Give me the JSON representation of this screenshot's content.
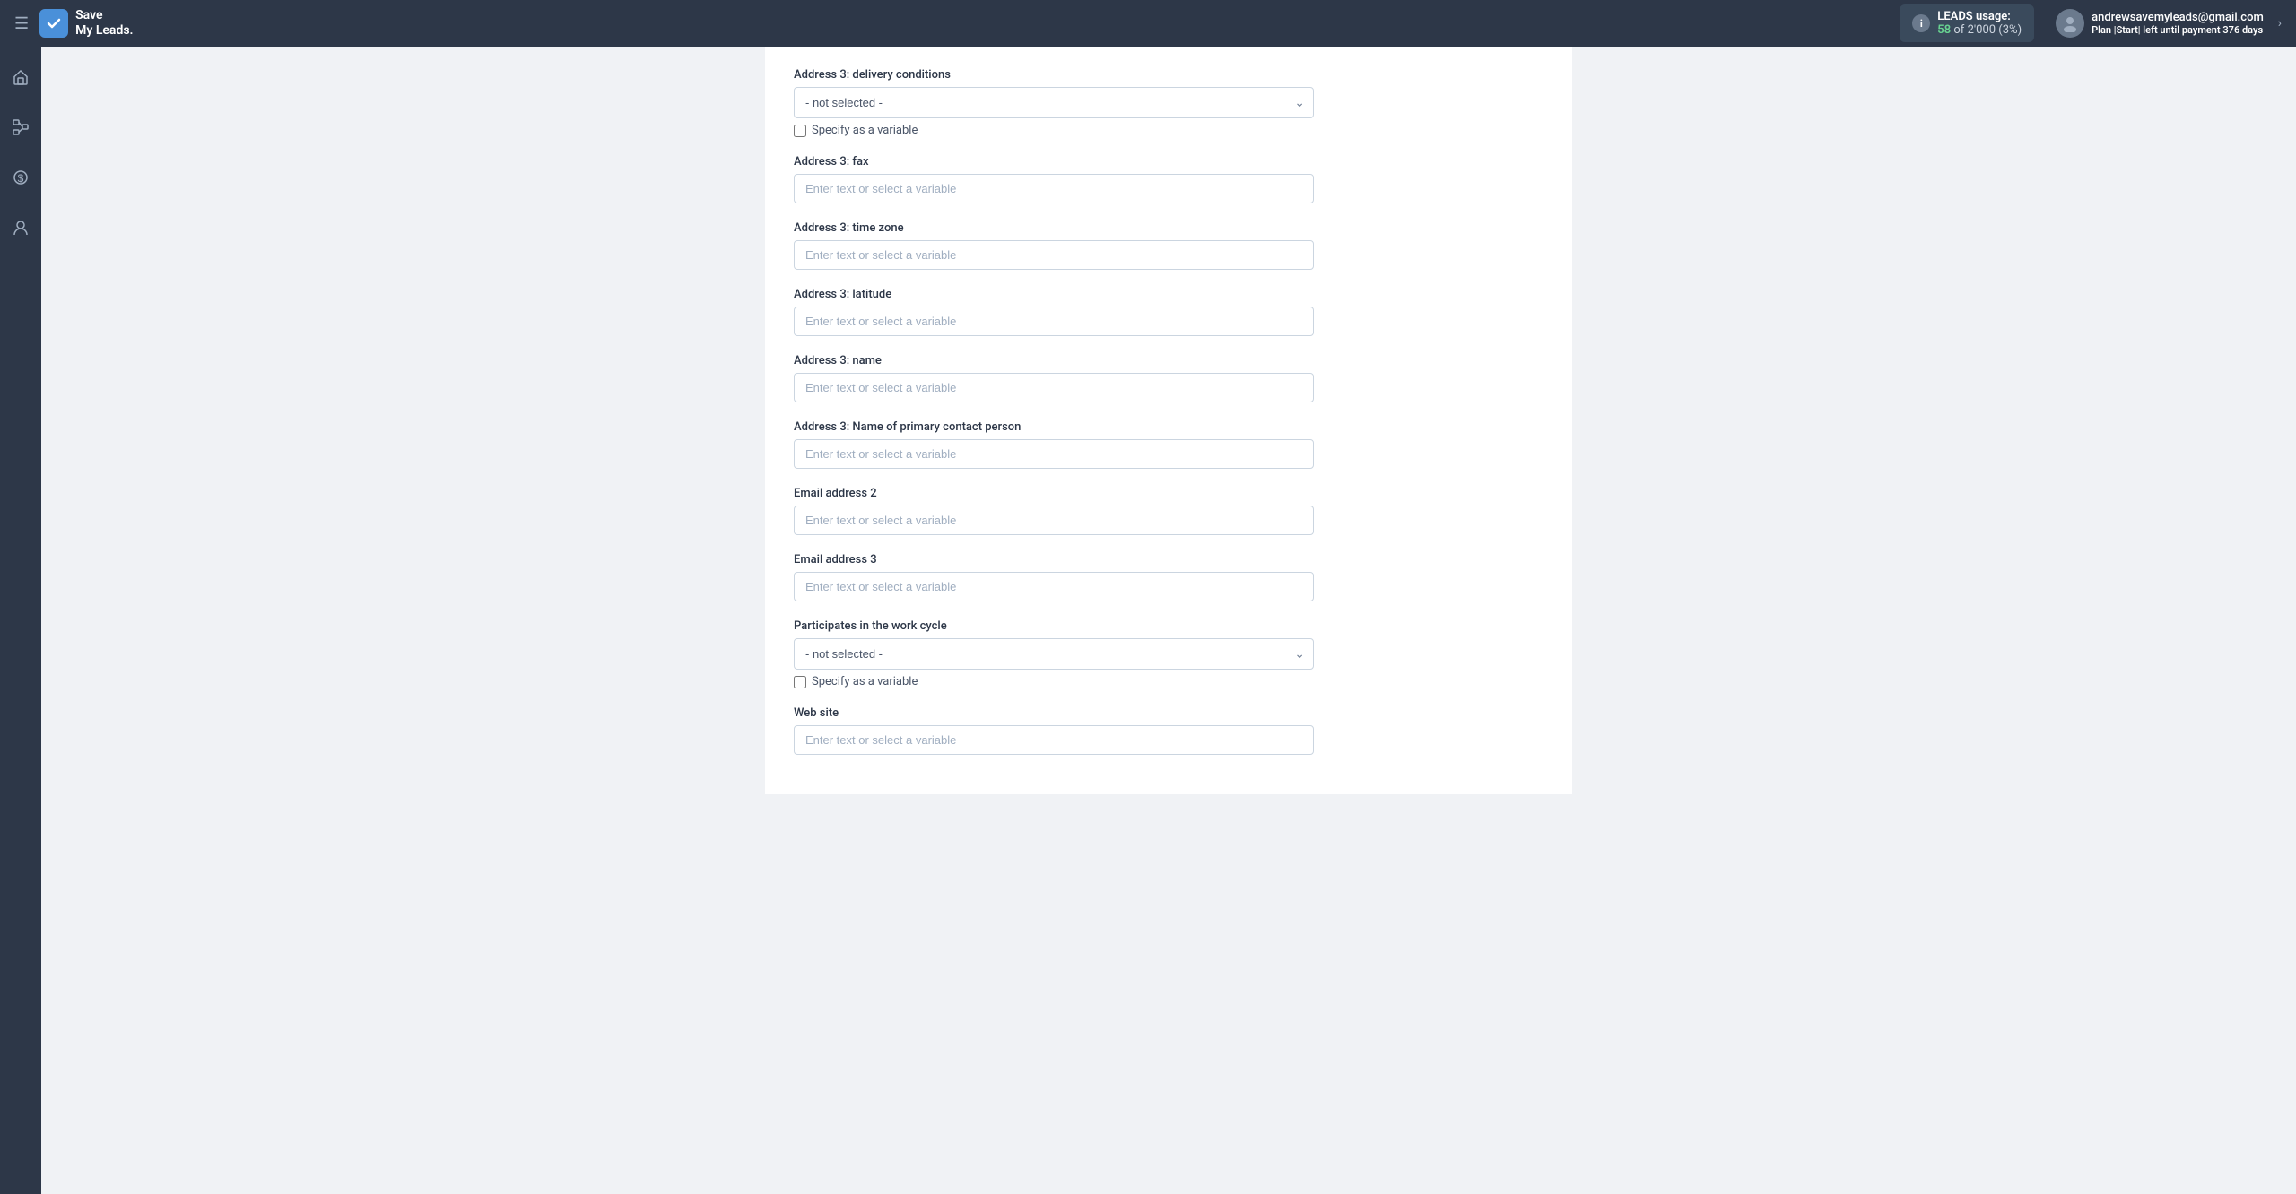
{
  "topbar": {
    "menu_icon": "☰",
    "logo_check": "✓",
    "logo_line1": "Save",
    "logo_line2": "My Leads.",
    "leads_label": "LEADS usage:",
    "leads_used": "58",
    "leads_total": "2'000",
    "leads_pct": "(3%)",
    "user_email": "andrewsavemyleads@gmail.com",
    "user_plan_text": "Plan |Start| left until payment",
    "user_days": "376 days",
    "chevron": "›"
  },
  "sidebar": {
    "icons": [
      "⌂",
      "⊞",
      "$",
      "👤"
    ]
  },
  "form": {
    "fields": [
      {
        "type": "select",
        "label": "Address 3: delivery conditions",
        "value": "- not selected -",
        "has_checkbox": true,
        "checkbox_label": "Specify as a variable",
        "id": "delivery-conditions"
      },
      {
        "type": "input",
        "label": "Address 3: fax",
        "placeholder": "Enter text or select a variable",
        "id": "fax"
      },
      {
        "type": "input",
        "label": "Address 3: time zone",
        "placeholder": "Enter text or select a variable",
        "id": "time-zone"
      },
      {
        "type": "input",
        "label": "Address 3: latitude",
        "placeholder": "Enter text or select a variable",
        "id": "latitude"
      },
      {
        "type": "input",
        "label": "Address 3: name",
        "placeholder": "Enter text or select a variable",
        "id": "name"
      },
      {
        "type": "input",
        "label": "Address 3: Name of primary contact person",
        "placeholder": "Enter text or select a variable",
        "id": "primary-contact"
      },
      {
        "type": "input",
        "label": "Email address 2",
        "placeholder": "Enter text or select a variable",
        "id": "email-2"
      },
      {
        "type": "input",
        "label": "Email address 3",
        "placeholder": "Enter text or select a variable",
        "id": "email-3"
      },
      {
        "type": "select",
        "label": "Participates in the work cycle",
        "value": "- not selected -",
        "has_checkbox": true,
        "checkbox_label": "Specify as a variable",
        "id": "work-cycle"
      },
      {
        "type": "input",
        "label": "Web site",
        "placeholder": "Enter text or select a variable",
        "id": "website"
      }
    ]
  }
}
